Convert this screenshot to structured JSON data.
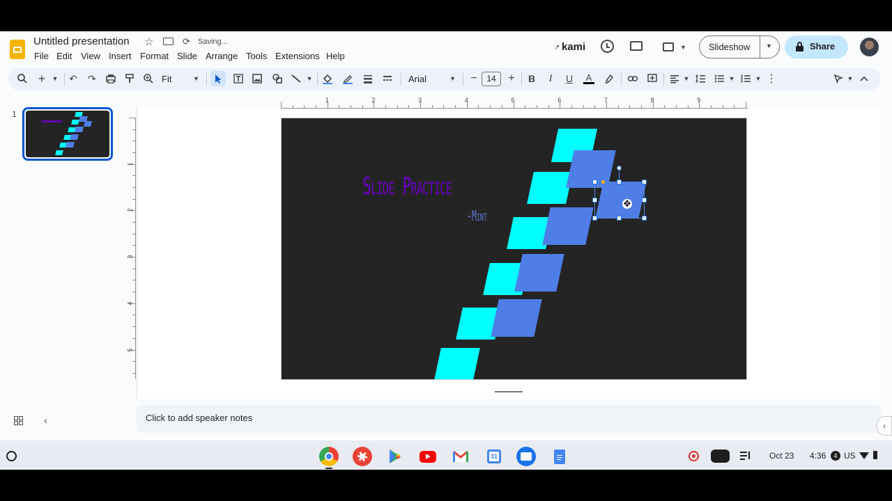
{
  "app": {
    "doc_title": "Untitled presentation",
    "save_status": "Saving...",
    "kami_label": "kami",
    "slideshow_label": "Slideshow",
    "share_label": "Share"
  },
  "menu": [
    "File",
    "Edit",
    "View",
    "Insert",
    "Format",
    "Slide",
    "Arrange",
    "Tools",
    "Extensions",
    "Help"
  ],
  "toolbar": {
    "zoom_value": "Fit",
    "font_name": "Arial",
    "font_size": "14"
  },
  "ruler": {
    "h_labels": [
      "1",
      "2",
      "3",
      "4",
      "5",
      "6",
      "7",
      "8",
      "9"
    ],
    "v_labels": [
      "1",
      "2",
      "3",
      "4",
      "5"
    ]
  },
  "filmstrip": {
    "slide_number": "1"
  },
  "slide": {
    "title": "Slide Practice",
    "subtitle": "-Mint",
    "background": "#242424",
    "title_color": "#6b00c9",
    "subtitle_color": "#5c7ad8",
    "accent_cyan": "#00ffff",
    "accent_blue": "#4e7ee6"
  },
  "notes": {
    "placeholder": "Click to add speaker notes"
  },
  "shelf": {
    "date": "Oct 23",
    "time": "4:36",
    "notification_count": "4",
    "locale": "US",
    "apps": [
      "chrome-icon",
      "palette-icon",
      "play-store-icon",
      "youtube-icon",
      "gmail-icon",
      "calendar-icon",
      "files-icon",
      "docs-icon"
    ]
  }
}
